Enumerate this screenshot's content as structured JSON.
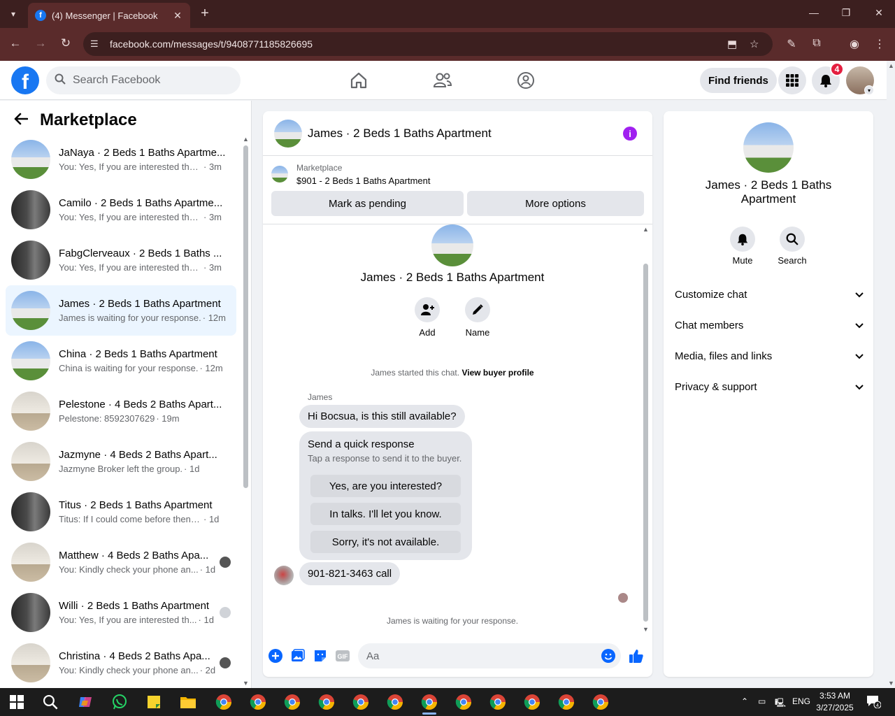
{
  "browser": {
    "tab_title": "(4) Messenger | Facebook",
    "url": "facebook.com/messages/t/9408771185826695"
  },
  "fb": {
    "search_placeholder": "Search Facebook",
    "find_friends": "Find friends",
    "notification_count": "4"
  },
  "sidebar": {
    "title": "Marketplace",
    "chats": [
      {
        "name": "JaNaya · 2 Beds 1 Baths Apartme...",
        "snippet": "You: Yes, If you are interested then...",
        "time": "· 3m",
        "thumb": "house"
      },
      {
        "name": "Camilo · 2 Beds 1 Baths Apartme...",
        "snippet": "You: Yes, If you are interested then...",
        "time": "· 3m",
        "thumb": "kitchen"
      },
      {
        "name": "FabgClerveaux · 2 Beds 1 Baths ...",
        "snippet": "You: Yes, If you are interested then...",
        "time": "· 3m",
        "thumb": "kitchen"
      },
      {
        "name": "James · 2 Beds 1 Baths Apartment",
        "snippet": "James is waiting for your response.",
        "time": "· 12m",
        "thumb": "house"
      },
      {
        "name": "China · 2 Beds 1 Baths Apartment",
        "snippet": "China is waiting for your response.",
        "time": "· 12m",
        "thumb": "house"
      },
      {
        "name": "Pelestone · 4 Beds 2 Baths Apart...",
        "snippet": "Pelestone: 8592307629",
        "time": "· 19m",
        "thumb": "room"
      },
      {
        "name": "Jazmyne · 4 Beds 2 Baths Apart...",
        "snippet": "Jazmyne Broker left the group.",
        "time": "· 1d",
        "thumb": "room"
      },
      {
        "name": "Titus · 2 Beds 1 Baths Apartment",
        "snippet": "Titus: If I could come before then, t...",
        "time": "· 1d",
        "thumb": "kitchen"
      },
      {
        "name": "Matthew · 4 Beds 2 Baths Apa...",
        "snippet": "You: Kindly check your phone an...",
        "time": "· 1d",
        "thumb": "room"
      },
      {
        "name": "Willi · 2 Beds 1 Baths Apartment",
        "snippet": "You: Yes, If you are interested th...",
        "time": "· 1d",
        "thumb": "kitchen"
      },
      {
        "name": "Christina · 4 Beds 2 Baths Apa...",
        "snippet": "You: Kindly check your phone an...",
        "time": "· 2d",
        "thumb": "room"
      }
    ]
  },
  "chat": {
    "title": "James · 2 Beds 1 Baths Apartment",
    "marketplace_label": "Marketplace",
    "listing": "$901 - 2 Beds 1 Baths Apartment",
    "mark_pending": "Mark as pending",
    "more_options": "More options",
    "add_label": "Add",
    "name_label": "Name",
    "started_text": "James started this chat.",
    "view_profile": "View buyer profile",
    "sender": "James",
    "message1": "Hi Bocsua, is this still available?",
    "quick_title": "Send a quick response",
    "quick_sub": "Tap a response to send it to the buyer.",
    "quick_replies": [
      "Yes, are you interested?",
      "In talks. I'll let you know.",
      "Sorry, it's not available."
    ],
    "message2": "901-821-3463 call",
    "waiting": "James is waiting for your response.",
    "composer_placeholder": "Aa"
  },
  "details": {
    "name": "James · 2 Beds 1 Baths Apartment",
    "mute": "Mute",
    "search": "Search",
    "sections": [
      "Customize chat",
      "Chat members",
      "Media, files and links",
      "Privacy & support"
    ]
  },
  "taskbar": {
    "lang": "ENG",
    "time": "3:53 AM",
    "date": "3/27/2025",
    "notif": "4"
  }
}
